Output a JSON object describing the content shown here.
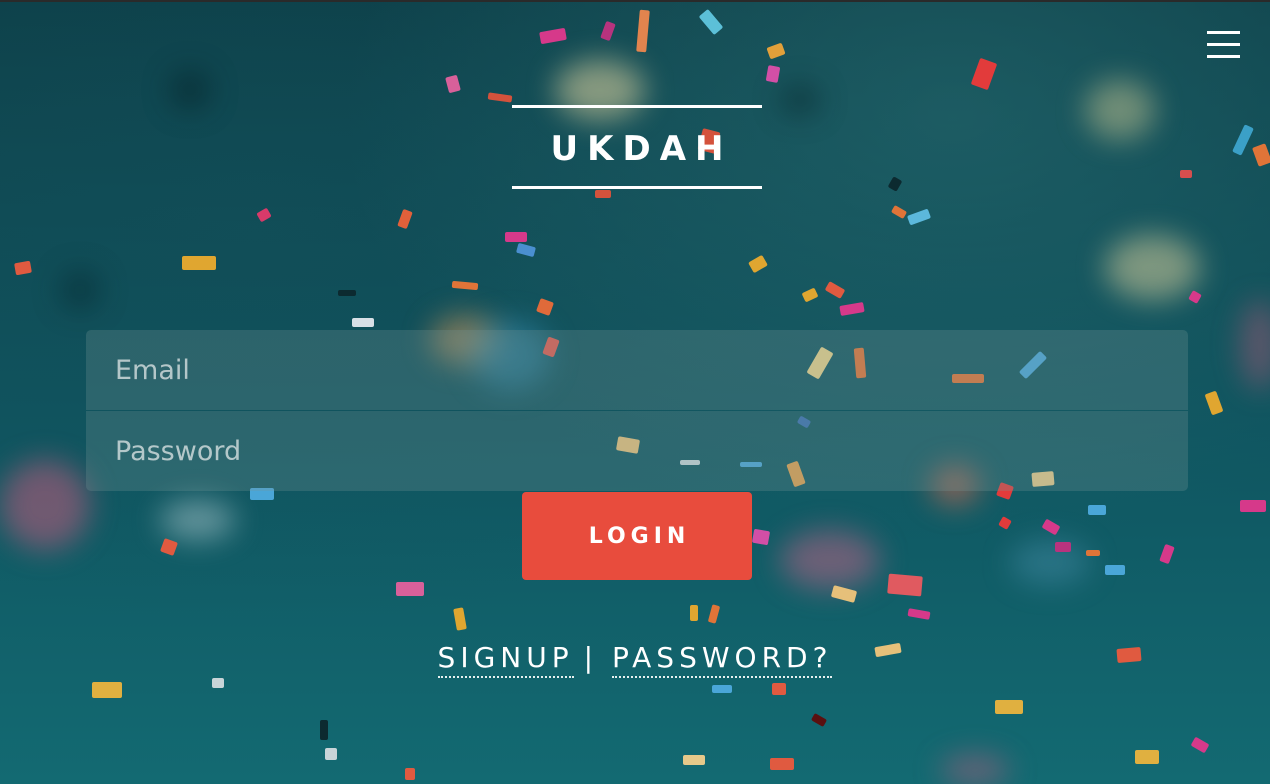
{
  "brand": {
    "name": "UKDAH"
  },
  "menu": {
    "icon": "hamburger-menu-icon"
  },
  "form": {
    "email_placeholder": "Email",
    "password_placeholder": "Password",
    "login_label": "LOGIN"
  },
  "links": {
    "signup_label": "SIGNUP",
    "separator": "|",
    "password_label": "PASSWORD?"
  },
  "colors": {
    "accent": "#e84c3d",
    "background": "#0f5560"
  }
}
